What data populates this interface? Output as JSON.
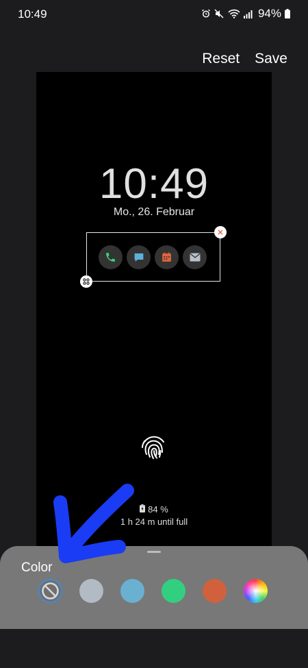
{
  "status_bar": {
    "time": "10:49",
    "battery": "94%",
    "icons": [
      "alarm-icon",
      "mute-icon",
      "wifi-icon",
      "signal-icon",
      "battery-icon"
    ]
  },
  "actions": {
    "reset": "Reset",
    "save": "Save"
  },
  "lockscreen": {
    "time": "10:49",
    "date": "Mo., 26. Februar",
    "charge_percent": "84 %",
    "charge_time": "1 h 24 m until full",
    "widget_apps": [
      "phone-icon",
      "messages-icon",
      "calendar-icon",
      "email-icon"
    ]
  },
  "color_panel": {
    "title": "Color",
    "selected": "none",
    "options": [
      {
        "name": "none",
        "color": "#6f6f6f"
      },
      {
        "name": "gray",
        "color": "#b2bac3"
      },
      {
        "name": "blue",
        "color": "#6ab1d1"
      },
      {
        "name": "green",
        "color": "#33cf80"
      },
      {
        "name": "orange",
        "color": "#d1613d"
      },
      {
        "name": "custom",
        "color": "conic"
      }
    ]
  },
  "colors": {
    "accent": "#3f8bd8",
    "annotation": "#1a3cf5",
    "phone": "#3ecf7c",
    "message": "#5fb0d8",
    "calendar": "#e0643c",
    "email": "#b8c2cc"
  }
}
